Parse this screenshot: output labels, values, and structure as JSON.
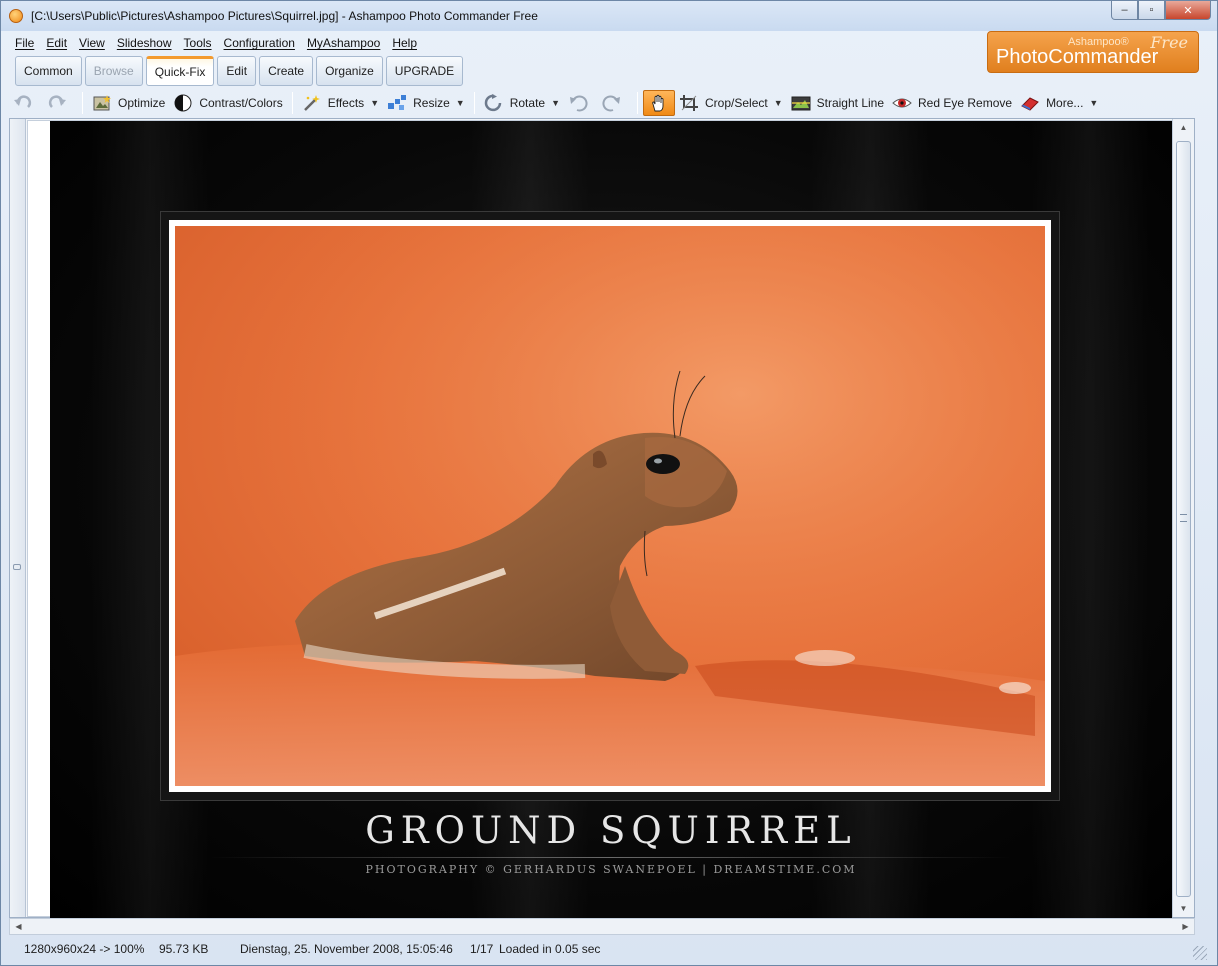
{
  "window": {
    "title": "[C:\\Users\\Public\\Pictures\\Ashampoo Pictures\\Squirrel.jpg] - Ashampoo Photo Commander Free",
    "buttons": {
      "minimize": "–",
      "maximize": "▫",
      "close": "✕"
    }
  },
  "menu": [
    "File",
    "Edit",
    "View",
    "Slideshow",
    "Tools",
    "Configuration",
    "MyAshampoo",
    "Help"
  ],
  "logo": {
    "small": "Ashampoo®",
    "main": "PhotoCommander",
    "free": "Free"
  },
  "tabs": [
    {
      "label": "Common",
      "state": "normal"
    },
    {
      "label": "Browse",
      "state": "disabled"
    },
    {
      "label": "Quick-Fix",
      "state": "active"
    },
    {
      "label": "Edit",
      "state": "normal"
    },
    {
      "label": "Create",
      "state": "normal"
    },
    {
      "label": "Organize",
      "state": "normal"
    },
    {
      "label": "UPGRADE",
      "state": "normal"
    }
  ],
  "toolbar": {
    "optimize": "Optimize",
    "contrast": "Contrast/Colors",
    "effects": "Effects",
    "resize": "Resize",
    "rotate": "Rotate",
    "crop": "Crop/Select",
    "straight_line": "Straight Line",
    "red_eye": "Red Eye Remove",
    "more": "More..."
  },
  "image": {
    "title": "GROUND SQUIRREL",
    "credit": "PHOTOGRAPHY © GERHARDUS SWANEPOEL | DREAMSTIME.COM"
  },
  "status": {
    "dimensions": "1280x960x24 -> 100%",
    "size": "95.73 KB",
    "date": "Dienstag, 25. November 2008, 15:05:46",
    "position": "1/17",
    "loaded": "Loaded in 0.05 sec"
  },
  "colors": {
    "accent": "#f08a16",
    "photo_background": "#e8743e",
    "poster_background": "#0a0a0a"
  }
}
